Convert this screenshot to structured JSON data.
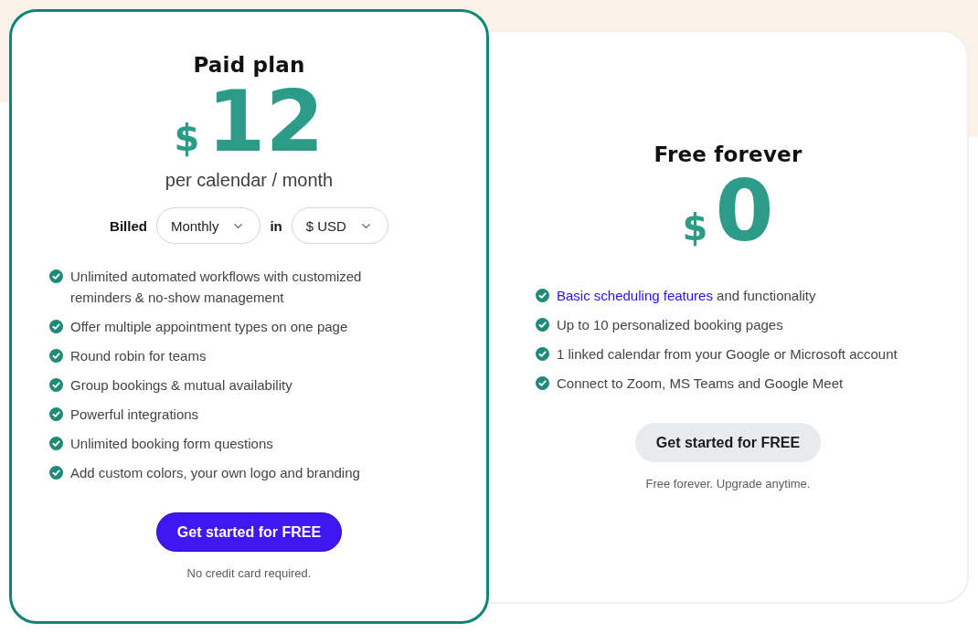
{
  "plans": [
    {
      "name": "Paid plan",
      "featured": true,
      "price": {
        "currency_symbol": "$",
        "amount": "12"
      },
      "period": "per calendar / month",
      "billing": {
        "label": "Billed",
        "frequency": "Monthly",
        "connector": "in",
        "currency": "$ USD"
      },
      "features": [
        {
          "text": "Unlimited automated workflows with customized reminders & no-show management"
        },
        {
          "text": "Offer multiple appointment types on one page"
        },
        {
          "text": "Round robin for teams"
        },
        {
          "text": "Group bookings & mutual availability"
        },
        {
          "text": "Powerful integrations"
        },
        {
          "text": "Unlimited booking form questions"
        },
        {
          "text": "Add custom colors, your own logo and branding"
        }
      ],
      "button": {
        "label": "Get started for FREE",
        "kind": "primary"
      },
      "note": "No credit card required."
    },
    {
      "name": "Free forever",
      "featured": false,
      "price": {
        "currency_symbol": "$",
        "amount": "0"
      },
      "features": [
        {
          "link": "Basic scheduling features",
          "text": "and functionality"
        },
        {
          "text": "Up to 10 personalized booking pages"
        },
        {
          "text": "1 linked calendar from your Google or Microsoft account"
        },
        {
          "text": "Connect to Zoom, MS Teams and Google Meet"
        }
      ],
      "button": {
        "label": "Get started for FREE",
        "kind": "secondary"
      },
      "note": "Free forever. Upgrade anytime."
    }
  ]
}
